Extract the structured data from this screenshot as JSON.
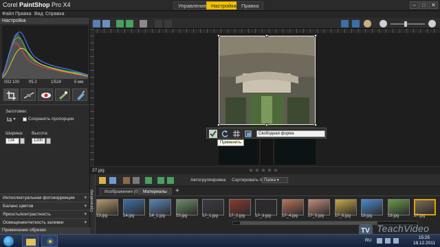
{
  "window": {
    "title_brand": "Corel",
    "title_product": "PaintShop",
    "title_version": "Pro X4",
    "tabs": [
      {
        "label": "Управление",
        "active": false
      },
      {
        "label": "Настройка",
        "active": true
      },
      {
        "label": "Правка",
        "active": false
      }
    ],
    "controls": {
      "minimize": "–",
      "maximize": "□",
      "close": "✕"
    }
  },
  "menu": [
    "Файл",
    "Правка",
    "Вид",
    "Справка"
  ],
  "left_panel": {
    "header": "Настройка",
    "exif": [
      "ISO 100",
      "f/5.2",
      "1/524",
      "5 мм"
    ],
    "presets_label": "Заготовки:",
    "keep_ratio_label": "Сохранять пропорции",
    "width_label": "Ширина:",
    "width_value": "724",
    "height_label": "Высота:",
    "height_value": "1200",
    "sections": [
      "Интеллектуальная фотокоррекция",
      "Баланс цветов",
      "Яркость/контрастность",
      "Освещение/четкость заливки"
    ],
    "footer": "Применение обрезки"
  },
  "crop_toolbar": {
    "mode": "Свободная форма",
    "tooltip": "Применить"
  },
  "file": {
    "name": "27.jpg",
    "rating_stars": 5,
    "rating_value": 0
  },
  "organizer": {
    "side_label": "Органайзер",
    "auto_group": "Автогруппировка",
    "sort_label": "Сортировать по:",
    "sort_value": "Папка",
    "tabs": [
      {
        "label": "Изображения (0)",
        "active": false
      },
      {
        "label": "Материалы",
        "active": true
      }
    ],
    "add_tab": "+",
    "thumbnails": [
      {
        "label": "13.jpg",
        "color": "#b59a6b",
        "selected": false
      },
      {
        "label": "14.jpg",
        "color": "#3d6fa6",
        "selected": false
      },
      {
        "label": "14_1.jpg",
        "color": "#5b86b8",
        "selected": false
      },
      {
        "label": "15.jpg",
        "color": "#6f8c6a",
        "selected": false
      },
      {
        "label": "17_1.jpg",
        "color": "#3e3a44",
        "selected": false
      },
      {
        "label": "17_2.jpg",
        "color": "#8a3b2e",
        "selected": false
      },
      {
        "label": "17_3.jpg",
        "color": "#2f2a30",
        "selected": false
      },
      {
        "label": "17_4.jpg",
        "color": "#b8755a",
        "selected": false
      },
      {
        "label": "17_5.jpg",
        "color": "#c58a7a",
        "selected": false
      },
      {
        "label": "17_6.jpg",
        "color": "#c7a94a",
        "selected": false
      },
      {
        "label": "18.jpg",
        "color": "#4d8ad1",
        "selected": false
      },
      {
        "label": "19.jpg",
        "color": "#6b9a4a",
        "selected": false
      },
      {
        "label": "27.jpg",
        "color": "#7d6a55",
        "selected": true
      }
    ]
  },
  "taskbar": {
    "lang": "RU",
    "time": "15:25",
    "date": "18.12.2011"
  },
  "watermark": "TeachVideo",
  "colors": {
    "accent": "#f2c200",
    "selection": "#e2a400",
    "bg": "#1b1b1b"
  }
}
